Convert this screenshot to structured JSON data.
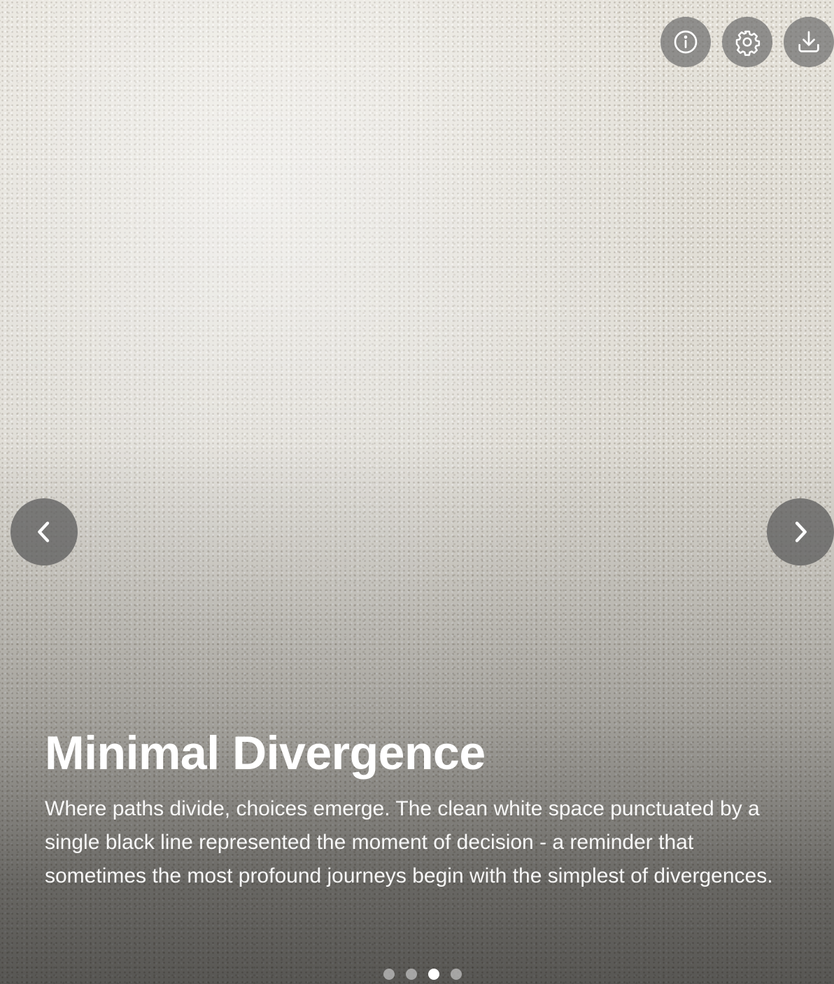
{
  "slide": {
    "title": "Minimal Divergence",
    "description": "Where paths divide, choices emerge. The clean white space punctuated by a single black line represented the moment of decision - a reminder that sometimes the most profound journeys begin with the simplest of divergences."
  },
  "toolbar": {
    "icons": [
      "info-icon",
      "gear-icon",
      "download-icon"
    ]
  },
  "navigation": {
    "prev_icon": "chevron-left-icon",
    "next_icon": "chevron-right-icon"
  },
  "pagination": {
    "total": 4,
    "active_index": 2
  },
  "colors": {
    "text": "#ffffff",
    "button_bg": "#6e6e6e",
    "dot_active": "#ffffff",
    "dot_inactive": "#c8c8c8"
  }
}
